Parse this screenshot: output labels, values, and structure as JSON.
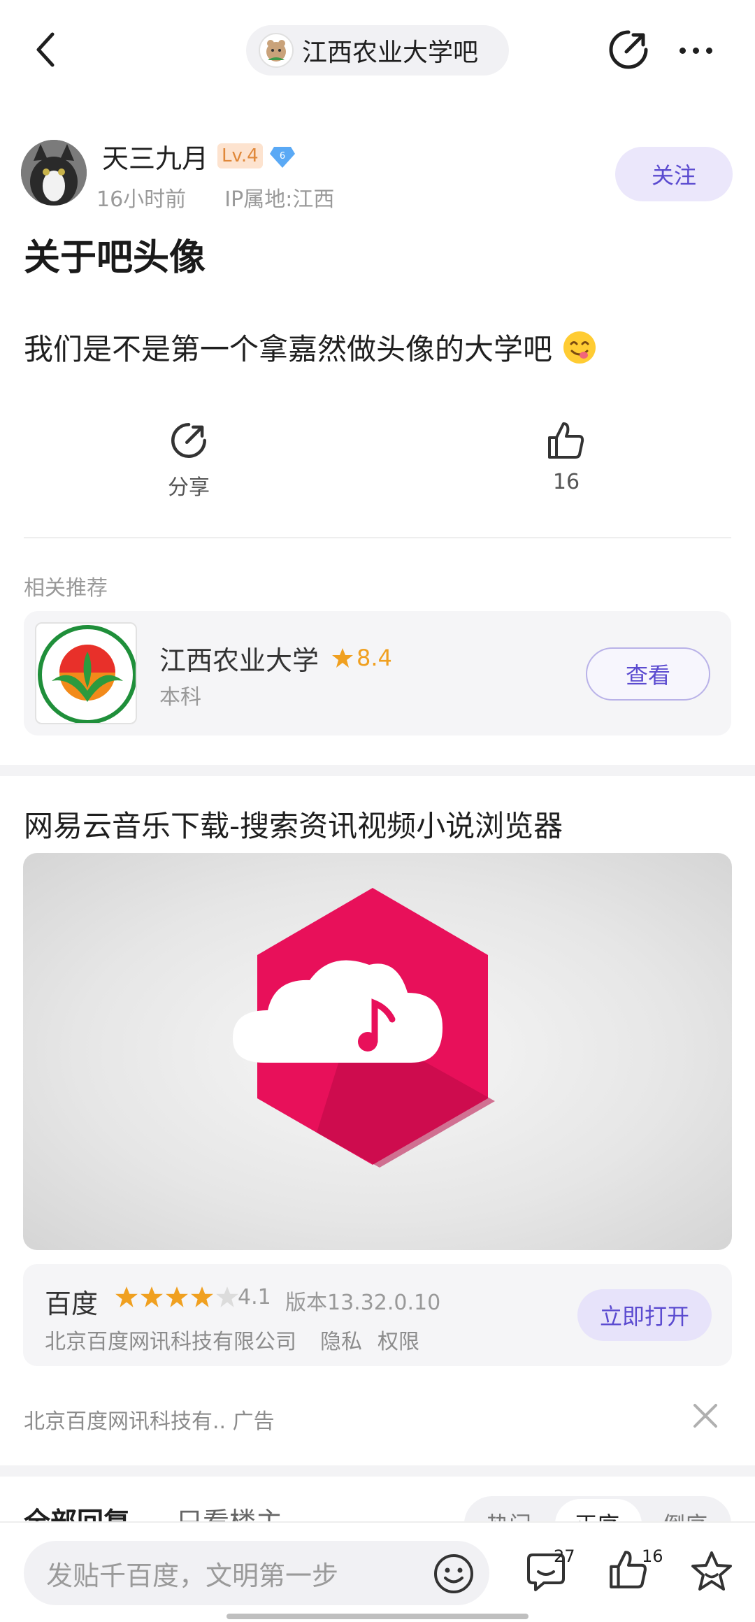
{
  "header": {
    "forum_name": "江西农业大学吧"
  },
  "author": {
    "name": "天三九月",
    "level": "Lv.4",
    "badge_num": "6",
    "time": "16小时前",
    "ip": "IP属地:江西",
    "follow_label": "关注"
  },
  "post": {
    "title": "关于吧头像",
    "body": "我们是不是第一个拿嘉然做头像的大学吧"
  },
  "actions": {
    "share_label": "分享",
    "like_count": "16"
  },
  "related": {
    "section_label": "相关推荐",
    "name": "江西农业大学",
    "rating": "8.4",
    "type": "本科",
    "view_label": "查看"
  },
  "ad": {
    "title": "网易云音乐下载-搜索资讯视频小说浏览器",
    "app_name": "百度",
    "stars": 4.1,
    "score": "4.1",
    "version": "版本13.32.0.10",
    "company": "北京百度网讯科技有限公司",
    "privacy": "隐私",
    "permission": "权限",
    "open_label": "立即打开",
    "source": "北京百度网讯科技有..  广告"
  },
  "replies": {
    "all_label": "全部回复",
    "op_label": "只看楼主",
    "sort_hot": "热门",
    "sort_time": "正序",
    "sort_reverse": "倒序"
  },
  "bottom_bar": {
    "placeholder": "发贴千百度，文明第一步",
    "comment_count": "27",
    "like_count": "16"
  },
  "colors": {
    "accent": "#5b4bd0",
    "accent_bg": "#ebe7fb",
    "star": "#f0a020",
    "ad_icon": "#e8105a"
  }
}
